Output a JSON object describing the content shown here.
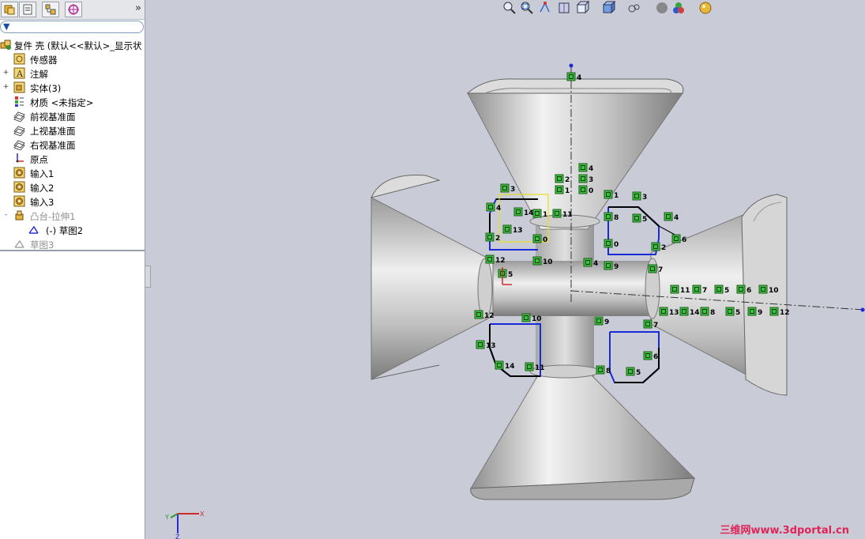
{
  "feature_tree": {
    "filter_placeholder": "",
    "root_label": "复件 壳  (默认<<默认>_显示状",
    "items": [
      {
        "label": "传感器",
        "icon": "sensor-icon",
        "expand": ""
      },
      {
        "label": "注解",
        "icon": "annotation-icon",
        "expand": "+"
      },
      {
        "label": "实体(3)",
        "icon": "solid-bodies-icon",
        "expand": "+"
      },
      {
        "label": "材质 <未指定>",
        "icon": "material-icon",
        "expand": ""
      },
      {
        "label": "前视基准面",
        "icon": "plane-icon",
        "expand": ""
      },
      {
        "label": "上视基准面",
        "icon": "plane-icon",
        "expand": ""
      },
      {
        "label": "右视基准面",
        "icon": "plane-icon",
        "expand": ""
      },
      {
        "label": "原点",
        "icon": "origin-icon",
        "expand": ""
      },
      {
        "label": "输入1",
        "icon": "import-icon",
        "expand": ""
      },
      {
        "label": "输入2",
        "icon": "import-icon",
        "expand": ""
      },
      {
        "label": "输入3",
        "icon": "import-icon",
        "expand": ""
      },
      {
        "label": "凸台-拉伸1",
        "icon": "boss-extrude-icon",
        "expand": "-"
      },
      {
        "label": "(-) 草图2",
        "icon": "sketch-icon",
        "expand": ""
      },
      {
        "label": "草图3",
        "icon": "sketch-icon",
        "expand": ""
      }
    ]
  },
  "tabs": [
    "feature-manager-tab",
    "property-manager-tab",
    "configuration-manager-tab",
    "dimxpert-tab"
  ],
  "tab_more": "»",
  "toolbar": [
    "zoom-to-fit-icon",
    "zoom-area-icon",
    "previous-view-icon",
    "section-view-icon",
    "view-orientation-icon",
    "display-style-icon",
    "hide-show-items-icon",
    "edit-appearance-icon",
    "apply-scene-icon",
    "view-settings-icon"
  ],
  "sketch_relations": {
    "upper_left": [
      "3",
      "4",
      "14",
      "1",
      "11",
      "13",
      "2",
      "0",
      "12",
      "10",
      "5"
    ],
    "upper_center": [
      "4",
      "2",
      "3",
      "1",
      "0"
    ],
    "upper_right": [
      "1",
      "3",
      "8",
      "5",
      "4",
      "6",
      "0",
      "2",
      "7",
      "9",
      "4"
    ],
    "right_row1": [
      "11",
      "7",
      "5",
      "6",
      "10"
    ],
    "right_row2": [
      "13",
      "14",
      "8",
      "5",
      "9",
      "12"
    ],
    "lower_left": [
      "12",
      "10",
      "13",
      "14",
      "11"
    ],
    "lower_right": [
      "9",
      "7",
      "6",
      "8",
      "5"
    ],
    "top_axis": "4"
  },
  "triad": {
    "x": "X",
    "y": "Y",
    "z": "Z"
  },
  "watermark": "三维网www.3dportal.cn",
  "colors": {
    "sketch_line": "#1a2ad6",
    "relation_box": "#3fbf3f",
    "background": "#c9ccd7",
    "part": "#b8b8b8"
  }
}
